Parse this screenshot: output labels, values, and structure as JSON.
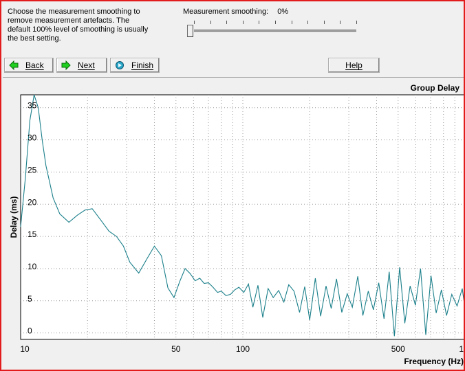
{
  "window": {
    "border_color": "#e21c1c"
  },
  "instructions": {
    "text": "Choose the measurement smoothing  to\nremove measurement artefacts.  The\ndefault 100% level of smoothing is usually\nthe best setting."
  },
  "smoothing": {
    "label": "Measurement smoothing:",
    "value": "0%",
    "level_percent": 0
  },
  "buttons": {
    "back": "Back",
    "next": "Next",
    "finish": "Finish",
    "help": "Help"
  },
  "icons": {
    "back": "green-left-arrow-icon",
    "next": "green-right-arrow-icon",
    "finish": "finish-dot-icon"
  },
  "chart_data": {
    "type": "line",
    "title": "Group Delay",
    "xlabel": "Frequency (Hz)",
    "ylabel": "Delay (ms)",
    "x_scale": "log",
    "xlim": [
      10,
      1000
    ],
    "ylim": [
      -1,
      37
    ],
    "x_tick_labels": [
      {
        "value": 10,
        "label": "10"
      },
      {
        "value": 50,
        "label": "50"
      },
      {
        "value": 100,
        "label": "100"
      },
      {
        "value": 500,
        "label": "500"
      },
      {
        "value": 1000,
        "label": "1"
      }
    ],
    "y_ticks": [
      0,
      5,
      10,
      15,
      20,
      25,
      30,
      35
    ],
    "grid": true,
    "line_color": "#1a7f8a",
    "series": [
      {
        "x": [
          10,
          10.5,
          11,
          11.5,
          12,
          12.5,
          13,
          14,
          15,
          16.5,
          18,
          19.5,
          21,
          23,
          25,
          27,
          29,
          31,
          34,
          37,
          40,
          43,
          46,
          49,
          52,
          55,
          58,
          61,
          64,
          67,
          70,
          73,
          77,
          80,
          84,
          88,
          92,
          96,
          101,
          106,
          111,
          117,
          123,
          130,
          137,
          145,
          153,
          161,
          170,
          180,
          190,
          200,
          212,
          224,
          237,
          250,
          264,
          279,
          295,
          311,
          329,
          347,
          367,
          387,
          409,
          432,
          456,
          481,
          508,
          536,
          566,
          598,
          631,
          666,
          703,
          742,
          783,
          826,
          872,
          921,
          972,
          1000
        ],
        "y": [
          16.5,
          24,
          33,
          37,
          35,
          30,
          26,
          21,
          18.5,
          17.2,
          18.3,
          19.1,
          19.3,
          17.5,
          15.8,
          15,
          13.5,
          11,
          9.3,
          11.5,
          13.5,
          12,
          7,
          5.5,
          8,
          10,
          9.2,
          8.1,
          8.5,
          7.7,
          7.8,
          7.2,
          6.3,
          6.5,
          5.8,
          6.0,
          6.7,
          7.1,
          6.3,
          7.6,
          4.0,
          7.4,
          2.4,
          6.9,
          5.5,
          6.6,
          4.8,
          7.5,
          6.5,
          3.2,
          7.2,
          2.0,
          8.5,
          2.6,
          7.3,
          3.8,
          8.4,
          3.2,
          6.1,
          4.0,
          8.8,
          2.7,
          6.5,
          3.6,
          7.8,
          2.2,
          9.5,
          -0.5,
          10.2,
          1.5,
          7.3,
          4.3,
          10.0,
          -0.3,
          8.9,
          3.1,
          6.7,
          2.7,
          6.0,
          4.2,
          6.9,
          3.8
        ]
      }
    ]
  }
}
